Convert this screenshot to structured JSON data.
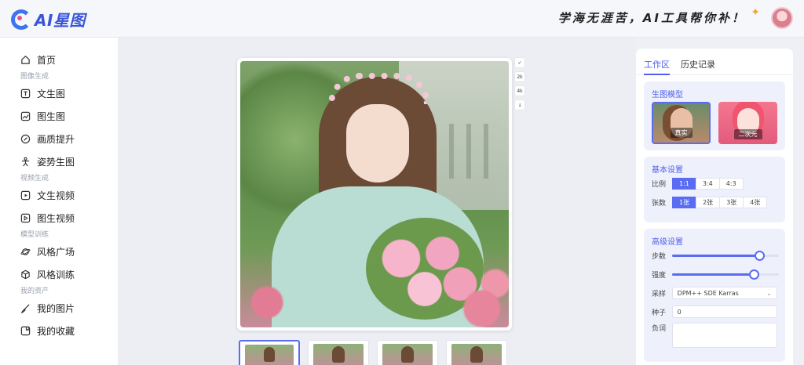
{
  "header": {
    "logo_text": "AI星图",
    "slogan": "学海无涯苦，AI工具帮你补！"
  },
  "sidebar": {
    "items": [
      {
        "type": "item",
        "label": "首页",
        "icon": "home-icon"
      },
      {
        "type": "section",
        "label": "图像生成"
      },
      {
        "type": "item",
        "label": "文生图",
        "icon": "text-image-icon"
      },
      {
        "type": "item",
        "label": "图生图",
        "icon": "image-image-icon"
      },
      {
        "type": "item",
        "label": "画质提升",
        "icon": "quality-icon"
      },
      {
        "type": "item",
        "label": "姿势生图",
        "icon": "pose-icon"
      },
      {
        "type": "section",
        "label": "视频生成"
      },
      {
        "type": "item",
        "label": "文生视频",
        "icon": "text-video-icon"
      },
      {
        "type": "item",
        "label": "图生视频",
        "icon": "image-video-icon"
      },
      {
        "type": "section",
        "label": "模型训练"
      },
      {
        "type": "item",
        "label": "风格广场",
        "icon": "planet-icon"
      },
      {
        "type": "item",
        "label": "风格训练",
        "icon": "cube-icon"
      },
      {
        "type": "section",
        "label": "我的资产"
      },
      {
        "type": "item",
        "label": "我的图片",
        "icon": "brush-icon"
      },
      {
        "type": "item",
        "label": "我的收藏",
        "icon": "bookmark-icon"
      }
    ]
  },
  "canvas": {
    "tools": [
      "✓",
      "2k",
      "4k",
      "↓"
    ],
    "thumbnail_count": 4
  },
  "panel": {
    "tabs": [
      "工作区",
      "历史记录"
    ],
    "active_tab": 0,
    "model_section": {
      "title": "生图模型",
      "models": [
        {
          "label": "真实",
          "selected": true
        },
        {
          "label": "二次元",
          "selected": false
        }
      ]
    },
    "basic_section": {
      "title": "基本设置",
      "ratio_label": "比例",
      "ratios": [
        "1:1",
        "3:4",
        "4:3"
      ],
      "ratio_active": 0,
      "count_label": "张数",
      "counts": [
        "1张",
        "2张",
        "3张",
        "4张"
      ],
      "count_active": 0
    },
    "advanced_section": {
      "title": "高级设置",
      "steps_label": "步数",
      "steps_fraction": 0.82,
      "strength_label": "强度",
      "strength_fraction": 0.77,
      "sampler_label": "采样",
      "sampler_value": "DPM++ SDE Karras",
      "seed_label": "种子",
      "seed_value": "0",
      "negative_label": "负词"
    }
  },
  "colors": {
    "accent": "#5a6cf2",
    "tab_active": "#4f5ff0"
  }
}
